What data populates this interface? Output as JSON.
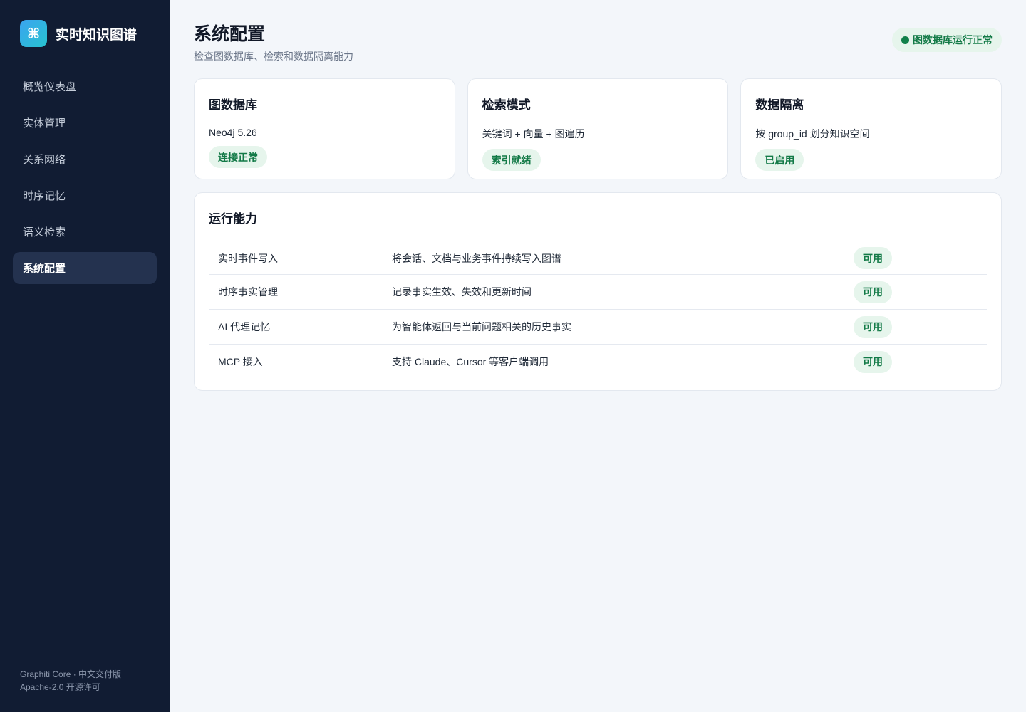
{
  "sidebar": {
    "brand_icon": "command-icon",
    "brand_glyph": "⌘",
    "brand_name": "实时知识图谱",
    "items": [
      {
        "label": "概览仪表盘"
      },
      {
        "label": "实体管理"
      },
      {
        "label": "关系网络"
      },
      {
        "label": "时序记忆"
      },
      {
        "label": "语义检索"
      },
      {
        "label": "系统配置",
        "active": true
      }
    ],
    "footer_line1": "Graphiti Core · 中文交付版",
    "footer_line2": "Apache-2.0 开源许可"
  },
  "header": {
    "title": "系统配置",
    "subtitle": "检查图数据库、检索和数据隔离能力",
    "status": "图数据库运行正常"
  },
  "cards": [
    {
      "title": "图数据库",
      "value": "Neo4j 5.26",
      "badge": "连接正常"
    },
    {
      "title": "检索模式",
      "value": "关键词 + 向量 + 图遍历",
      "badge": "索引就绪"
    },
    {
      "title": "数据隔离",
      "value": "按 group_id 划分知识空间",
      "badge": "已启用"
    }
  ],
  "capabilities": {
    "title": "运行能力",
    "rows": [
      {
        "name": "实时事件写入",
        "desc": "将会话、文档与业务事件持续写入图谱",
        "status": "可用"
      },
      {
        "name": "时序事实管理",
        "desc": "记录事实生效、失效和更新时间",
        "status": "可用"
      },
      {
        "name": "AI 代理记忆",
        "desc": "为智能体返回与当前问题相关的历史事实",
        "status": "可用"
      },
      {
        "name": "MCP 接入",
        "desc": "支持 Claude、Cursor 等客户端调用",
        "status": "可用"
      }
    ]
  },
  "colors": {
    "sidebar_bg": "#111c33",
    "accent_green": "#137a47",
    "badge_bg": "#e6f5ec",
    "page_bg": "#f3f6fa"
  }
}
